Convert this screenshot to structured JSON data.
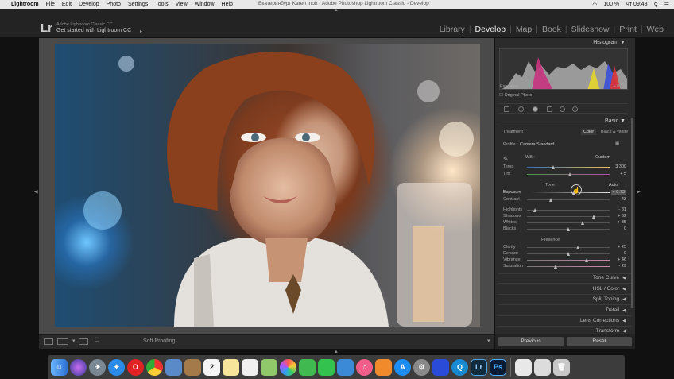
{
  "menubar": {
    "app": "Lightroom",
    "items": [
      "File",
      "Edit",
      "Develop",
      "Photo",
      "Settings",
      "Tools",
      "View",
      "Window",
      "Help"
    ],
    "window_title": "Екатеринбург Karen Inoh - Adobe Photoshop Lightroom Classic - Develop",
    "battery": "100 %",
    "clock": "Чт 09:48"
  },
  "lr_header": {
    "logo": "Lr",
    "identity_small": "Adobe Lightroom Classic CC",
    "identity_main": "Get started with Lightroom CC",
    "modules": [
      "Library",
      "Develop",
      "Map",
      "Book",
      "Slideshow",
      "Print",
      "Web"
    ],
    "active_module": "Develop"
  },
  "toolbar": {
    "soft_proofing": "Soft Proofing"
  },
  "right_panel": {
    "histogram_title": "Histogram",
    "exposure_label": "Exposure",
    "exposure_readout": "+ 0.73",
    "original_photo": "Original Photo",
    "basic_title": "Basic",
    "treatment_label": "Treatment :",
    "treatment_color": "Color",
    "treatment_bw": "Black & White",
    "profile_label": "Profile :",
    "profile_value": "Camera Standard",
    "wb_label": "WB :",
    "wb_value": "Custom",
    "temp": {
      "label": "Temp",
      "value": "3 300",
      "pos": 0.32
    },
    "tint": {
      "label": "Tint",
      "value": "+ 5",
      "pos": 0.52
    },
    "tone_label": "Tone",
    "auto_label": "Auto",
    "exposure": {
      "label": "Exposure",
      "value": "+ 0.73",
      "pos": 0.57
    },
    "contrast": {
      "label": "Contrast",
      "value": "- 43",
      "pos": 0.29
    },
    "highlights": {
      "label": "Highlights",
      "value": "- 81",
      "pos": 0.1
    },
    "shadows": {
      "label": "Shadows",
      "value": "+ 62",
      "pos": 0.81
    },
    "whites": {
      "label": "Whites",
      "value": "+ 35",
      "pos": 0.68
    },
    "blacks": {
      "label": "Blacks",
      "value": "0",
      "pos": 0.5
    },
    "presence_label": "Presence",
    "clarity": {
      "label": "Clarity",
      "value": "+ 25",
      "pos": 0.62
    },
    "dehaze": {
      "label": "Dehaze",
      "value": "0",
      "pos": 0.5
    },
    "vibrance": {
      "label": "Vibrance",
      "value": "+ 46",
      "pos": 0.73
    },
    "saturation": {
      "label": "Saturation",
      "value": "- 29",
      "pos": 0.35
    },
    "sections": [
      "Tone Curve",
      "HSL / Color",
      "Split Toning",
      "Detail",
      "Lens Corrections",
      "Transform"
    ],
    "previous_btn": "Previous",
    "reset_btn": "Reset"
  },
  "dock": {
    "calendar_day": "2",
    "items": [
      "finder-icon",
      "siri-icon",
      "launchpad-icon",
      "safari-icon",
      "opera-icon",
      "chrome-icon",
      "preview-icon",
      "notebook-icon",
      "calendar-icon",
      "notes-icon",
      "reminders-icon",
      "maps-icon",
      "photos-icon",
      "messages-icon",
      "facetime-icon",
      "keynote-icon",
      "itunes-icon",
      "books-icon",
      "appstore-icon",
      "system-prefs-icon",
      "sketch-icon",
      "quicktime-icon",
      "lightroom-icon",
      "photoshop-icon",
      "document-icon",
      "screen-icon",
      "trash-icon"
    ]
  },
  "colors": {
    "accent": "#eeeeee",
    "panel": "#2b2b2b"
  }
}
